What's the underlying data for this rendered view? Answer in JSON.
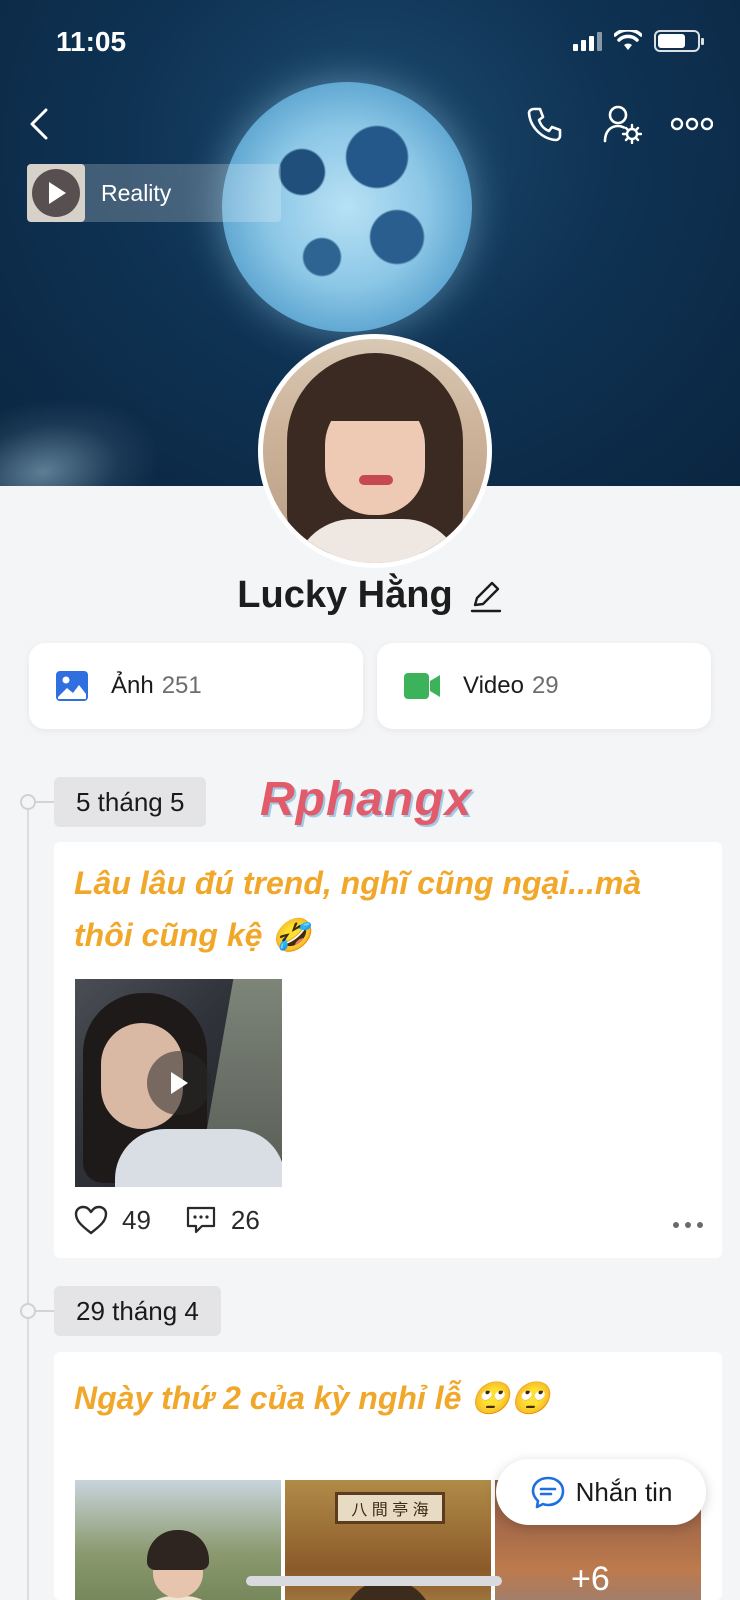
{
  "status_bar": {
    "time": "11:05"
  },
  "cover": {
    "music_title": "Reality"
  },
  "profile": {
    "name": "Lucky Hằng"
  },
  "media_tiles": [
    {
      "label": "Ảnh",
      "count": "251",
      "icon": "photo-icon"
    },
    {
      "label": "Video",
      "count": "29",
      "icon": "video-camera-icon"
    }
  ],
  "watermark": "Rphangx",
  "posts": [
    {
      "date": "5 tháng 5",
      "text_line1": "Lâu lâu đú trend, nghĩ cũng ngại...mà",
      "text_line2": "thôi cũng kệ 🤣",
      "likes": "49",
      "comments": "26"
    },
    {
      "date": "29 tháng 4",
      "text": "Ngày thứ 2 của kỳ nghỉ lễ 🙄🙄",
      "photo_sign": "八 間 亭 海",
      "more_photos": "+6"
    }
  ],
  "chat_button": {
    "label": "Nhắn tin"
  },
  "colors": {
    "post_text": "#f1a82a",
    "photo_icon": "#2f6fe0",
    "video_icon": "#3cb35a",
    "chat_icon": "#1f6fe0"
  }
}
